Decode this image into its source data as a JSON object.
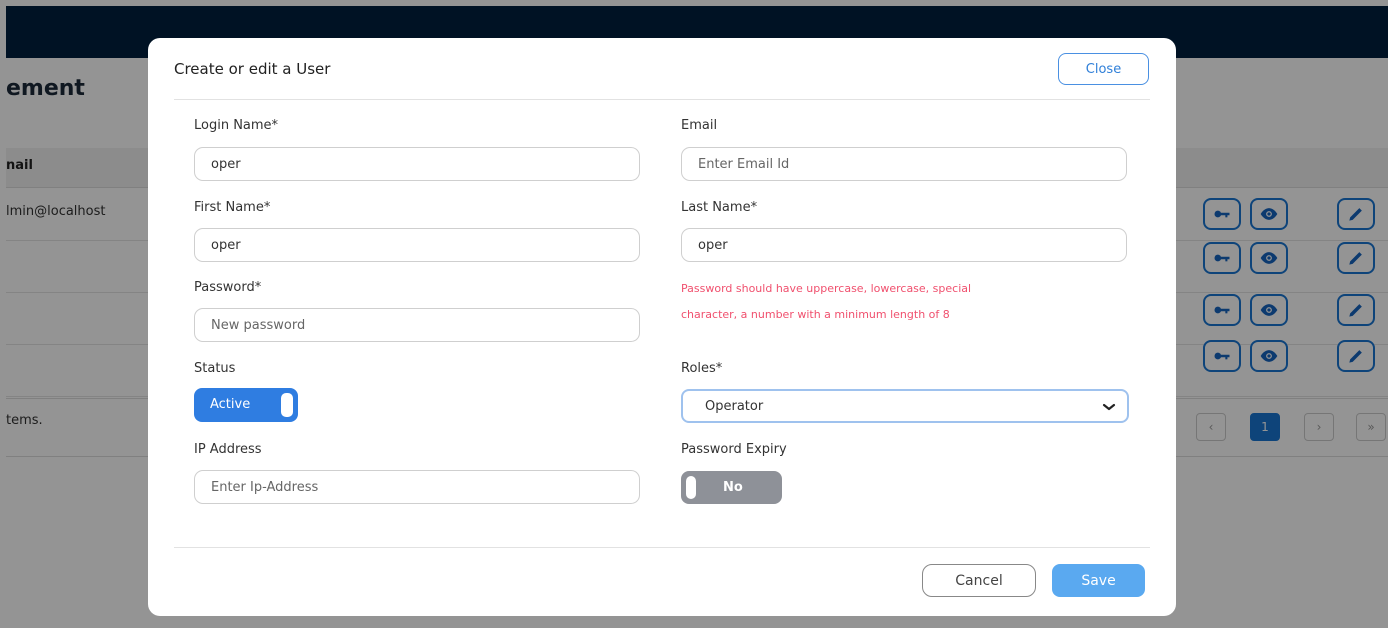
{
  "background": {
    "page_title_fragment": "ement",
    "table_header_fragment": "nail",
    "first_row_email_fragment": "lmin@localhost",
    "footer_text_fragment": "tems.",
    "pagination": {
      "prev": "‹",
      "current": "1",
      "next": "›",
      "last": "»"
    },
    "row_actions": [
      "key-icon",
      "eye-icon",
      "pencil-icon"
    ],
    "colors": {
      "topbar": "#001f3f",
      "accent": "#1976d2"
    }
  },
  "modal": {
    "title": "Create or edit a User",
    "close_label": "Close",
    "fields": {
      "login_name": {
        "label": "Login Name*",
        "value": "oper"
      },
      "email": {
        "label": "Email",
        "placeholder": "Enter Email Id"
      },
      "first_name": {
        "label": "First Name*",
        "value": "oper"
      },
      "last_name": {
        "label": "Last Name*",
        "value": "oper"
      },
      "password": {
        "label": "Password*",
        "placeholder": "New password"
      },
      "password_hint_line1": "Password should have uppercase, lowercase, special",
      "password_hint_line2": "character, a number with a minimum length of 8",
      "status": {
        "label": "Status",
        "value": "Active"
      },
      "roles": {
        "label": "Roles*",
        "value": "Operator"
      },
      "ip_address": {
        "label": "IP Address",
        "placeholder": "Enter Ip-Address"
      },
      "password_expiry": {
        "label": "Password Expiry",
        "value": "No"
      }
    },
    "cancel_label": "Cancel",
    "save_label": "Save",
    "colors": {
      "primary": "#2f7de1",
      "hint": "#f0506e",
      "save": "#5aa9f0"
    }
  }
}
